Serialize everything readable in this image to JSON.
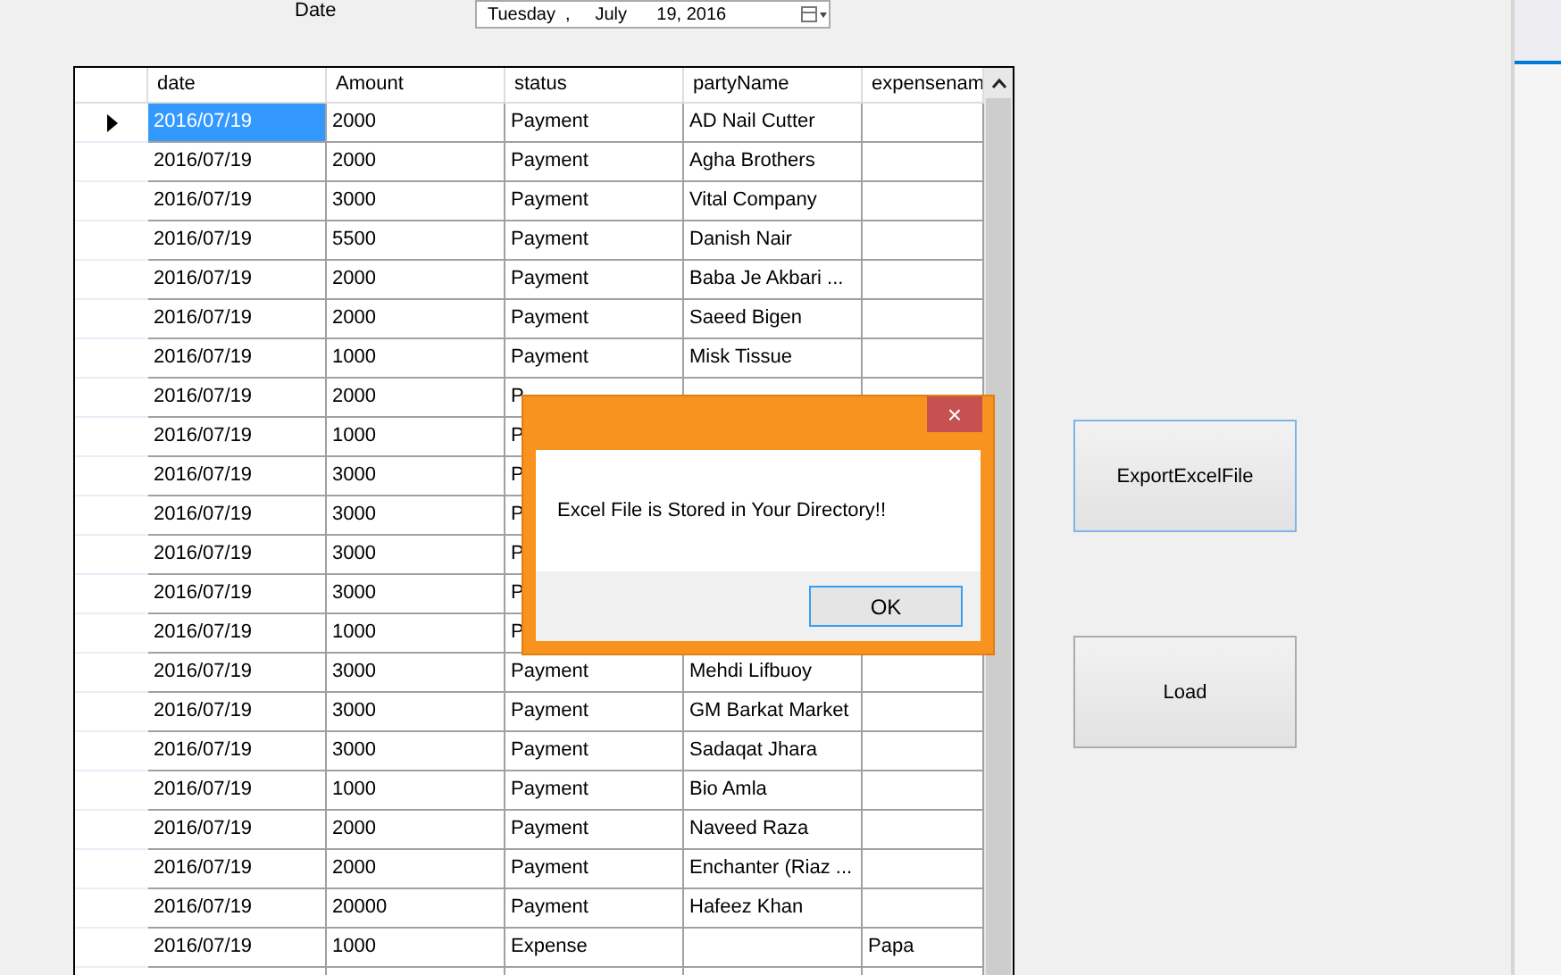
{
  "date_filter": {
    "label": "Date",
    "value": "Tuesday  ,     July      19, 2016"
  },
  "table": {
    "columns": [
      "date",
      "Amount",
      "status",
      "partyName",
      "expensenam"
    ],
    "rows": [
      {
        "cells": [
          "2016/07/19",
          "2000",
          "Payment",
          "AD Nail Cutter",
          ""
        ],
        "selected": true
      },
      {
        "cells": [
          "2016/07/19",
          "2000",
          "Payment",
          "Agha Brothers",
          ""
        ],
        "selected": false
      },
      {
        "cells": [
          "2016/07/19",
          "3000",
          "Payment",
          "Vital Company",
          ""
        ],
        "selected": false
      },
      {
        "cells": [
          "2016/07/19",
          "5500",
          "Payment",
          "Danish Nair",
          ""
        ],
        "selected": false
      },
      {
        "cells": [
          "2016/07/19",
          "2000",
          "Payment",
          "Baba Je Akbari ...",
          ""
        ],
        "selected": false
      },
      {
        "cells": [
          "2016/07/19",
          "2000",
          "Payment",
          "Saeed Bigen",
          ""
        ],
        "selected": false
      },
      {
        "cells": [
          "2016/07/19",
          "1000",
          "Payment",
          "Misk Tissue",
          ""
        ],
        "selected": false
      },
      {
        "cells": [
          "2016/07/19",
          "2000",
          "P",
          "",
          ""
        ],
        "selected": false
      },
      {
        "cells": [
          "2016/07/19",
          "1000",
          "P",
          "",
          ""
        ],
        "selected": false
      },
      {
        "cells": [
          "2016/07/19",
          "3000",
          "P",
          "",
          ""
        ],
        "selected": false
      },
      {
        "cells": [
          "2016/07/19",
          "3000",
          "P",
          "",
          ""
        ],
        "selected": false
      },
      {
        "cells": [
          "2016/07/19",
          "3000",
          "P",
          "",
          ""
        ],
        "selected": false
      },
      {
        "cells": [
          "2016/07/19",
          "3000",
          "P",
          "",
          ""
        ],
        "selected": false
      },
      {
        "cells": [
          "2016/07/19",
          "1000",
          "P",
          "",
          ""
        ],
        "selected": false
      },
      {
        "cells": [
          "2016/07/19",
          "3000",
          "Payment",
          "Mehdi Lifbuoy",
          ""
        ],
        "selected": false
      },
      {
        "cells": [
          "2016/07/19",
          "3000",
          "Payment",
          "GM Barkat Market",
          ""
        ],
        "selected": false
      },
      {
        "cells": [
          "2016/07/19",
          "3000",
          "Payment",
          "Sadaqat Jhara",
          ""
        ],
        "selected": false
      },
      {
        "cells": [
          "2016/07/19",
          "1000",
          "Payment",
          "Bio Amla",
          ""
        ],
        "selected": false
      },
      {
        "cells": [
          "2016/07/19",
          "2000",
          "Payment",
          "Naveed Raza",
          ""
        ],
        "selected": false
      },
      {
        "cells": [
          "2016/07/19",
          "2000",
          "Payment",
          "Enchanter (Riaz ...",
          ""
        ],
        "selected": false
      },
      {
        "cells": [
          "2016/07/19",
          "20000",
          "Payment",
          "Hafeez Khan",
          ""
        ],
        "selected": false
      },
      {
        "cells": [
          "2016/07/19",
          "1000",
          "Expense",
          "",
          "Papa"
        ],
        "selected": false
      },
      {
        "cells": [
          "",
          "",
          "",
          "",
          ""
        ],
        "selected": false
      }
    ]
  },
  "buttons": [
    "ExportExcelFile",
    "Load"
  ],
  "dialog": {
    "message": "Excel File  is Stored  in Your Directory!!",
    "close": "×",
    "ok": "OK"
  }
}
